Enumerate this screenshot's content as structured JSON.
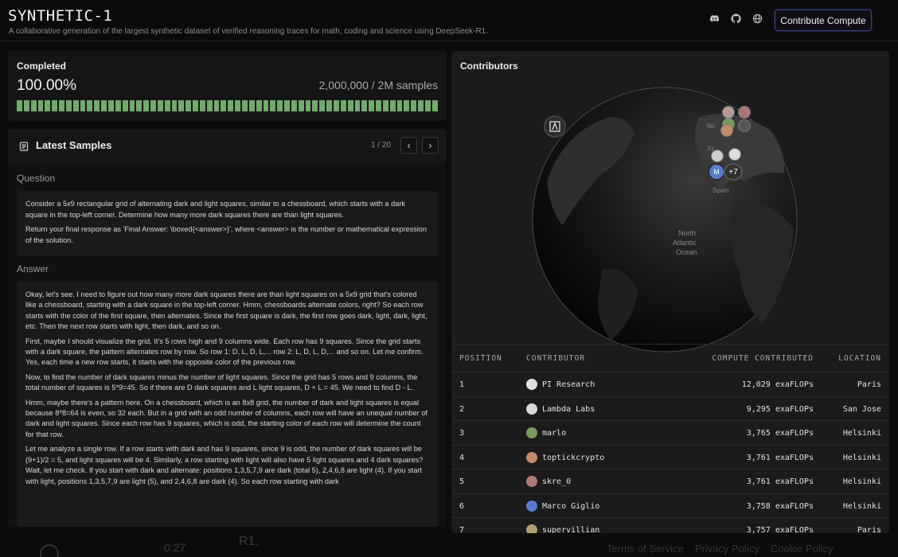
{
  "header": {
    "title": "SYNTHETIC-1",
    "subtitle": "A collaborative generation of the largest synthetic dataset of verified reasoning traces for math, coding and science using DeepSeek-R1.",
    "icons": [
      "discord-icon",
      "github-icon",
      "globe-icon"
    ],
    "contribute_label": "Contribute Compute"
  },
  "completed": {
    "label": "Completed",
    "percent": "100.00%",
    "samples": "2,000,000 / 2M samples",
    "progress_fraction": 1.0
  },
  "latest": {
    "title": "Latest Samples",
    "page_indicator": "1 / 20",
    "prev_icon": "chevron-left-icon",
    "next_icon": "chevron-right-icon"
  },
  "sample": {
    "question_label": "Question",
    "question": [
      "Consider a 5x9 rectangular grid of alternating dark and light squares, similar to a chessboard, which starts with a dark square in the top-left corner. Determine how many more dark squares there are than light squares.",
      "Return your final response as 'Final Answer: \\boxed{<answer>}', where <answer> is the number or mathematical expression of the solution."
    ],
    "answer_label": "Answer",
    "answer": [
      "Okay, let's see. I need to figure out how many more dark squares there are than light squares on a 5x9 grid that's colored like a chessboard, starting with a dark square in the top-left corner. Hmm, chessboards alternate colors, right? So each row starts with the color of the first square, then alternates. Since the first square is dark, the first row goes dark, light, dark, light, etc. Then the next row starts with light, then dark, and so on.",
      "First, maybe I should visualize the grid. It's 5 rows high and 9 columns wide. Each row has 9 squares. Since the grid starts with a dark square, the pattern alternates row by row. So row 1: D, L, D, L,... row 2: L, D, L, D,... and so on. Let me confirm. Yes, each time a new row starts, it starts with the opposite color of the previous row.",
      "Now, to find the number of dark squares minus the number of light squares. Since the grid has 5 rows and 9 columns, the total number of squares is 5*9=45. So if there are D dark squares and L light squares, D + L = 45. We need to find D - L.",
      "Hmm, maybe there's a pattern here. On a chessboard, which is an 8x8 grid, the number of dark and light squares is equal because 8*8=64 is even, so 32 each. But in a grid with an odd number of columns, each row will have an unequal number of dark and light squares. Since each row has 9 squares, which is odd, the starting color of each row will determine the count for that row.",
      "Let me analyze a single row. If a row starts with dark and has 9 squares, since 9 is odd, the number of dark squares will be (9+1)/2 = 5, and light squares will be 4. Similarly, a row starting with light will also have 5 light squares and 4 dark squares? Wait, let me check. If you start with dark and alternate: positions 1,3,5,7,9 are dark (total 5), 2,4,6,8 are light (4). If you start with light, positions 1,3,5,7,9 are light (5), and 2,4,6,8 are dark (4). So each row starting with dark"
    ]
  },
  "contributors": {
    "title": "Contributors",
    "map_labels": [
      "North Atlantic Ocean",
      "Spain",
      "No",
      "Fr",
      "+7"
    ],
    "table_headers": [
      "POSITION",
      "CONTRIBUTOR",
      "COMPUTE CONTRIBUTED",
      "LOCATION"
    ],
    "rows": [
      {
        "pos": "1",
        "name": "PI Research",
        "compute": "12,029 exaFLOPs",
        "loc": "Paris",
        "icon": "prime-intellect-icon",
        "color": "#e0e0e0"
      },
      {
        "pos": "2",
        "name": "Lambda Labs",
        "compute": "9,295 exaFLOPs",
        "loc": "San Jose",
        "icon": "lambda-icon",
        "color": "#d8d8d8"
      },
      {
        "pos": "3",
        "name": "marlo",
        "compute": "3,765 exaFLOPs",
        "loc": "Helsinki",
        "icon": "avatar-icon",
        "color": "#7a9a5a"
      },
      {
        "pos": "4",
        "name": "toptickcrypto",
        "compute": "3,761 exaFLOPs",
        "loc": "Helsinki",
        "icon": "avatar-icon",
        "color": "#c48a6a"
      },
      {
        "pos": "5",
        "name": "skre_0",
        "compute": "3,761 exaFLOPs",
        "loc": "Helsinki",
        "icon": "avatar-icon",
        "color": "#b07a7a"
      },
      {
        "pos": "6",
        "name": "Marco Giglio",
        "compute": "3,758 exaFLOPs",
        "loc": "Helsinki",
        "icon": "avatar-icon",
        "color": "#5a7ad0"
      },
      {
        "pos": "7",
        "name": "supervillian",
        "compute": "3,757 exaFLOPs",
        "loc": "Paris",
        "icon": "avatar-icon",
        "color": "#b0a070"
      }
    ]
  },
  "background": {
    "time": "0:27",
    "r1": "R1.",
    "footer_links": [
      "Terms of Service",
      "Privacy Policy",
      "Cookie Policy"
    ]
  }
}
